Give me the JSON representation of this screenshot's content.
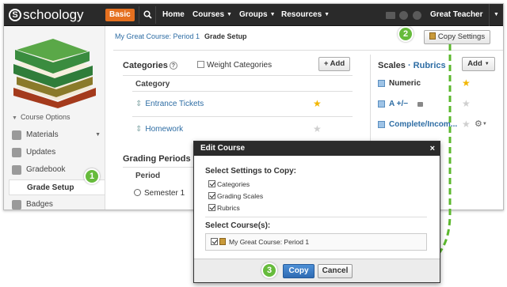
{
  "topbar": {
    "logo_text": "schoology",
    "plan_badge": "Basic",
    "nav": [
      {
        "label": "Home",
        "caret": ""
      },
      {
        "label": "Courses",
        "caret": "▼"
      },
      {
        "label": "Groups",
        "caret": "▼"
      },
      {
        "label": "Resources",
        "caret": "▼"
      }
    ],
    "user_name": "Great Teacher",
    "user_caret": "▼"
  },
  "sidebar": {
    "course_options": "Course Options",
    "items": [
      {
        "label": "Materials",
        "arrow": "▼"
      },
      {
        "label": "Updates",
        "arrow": ""
      },
      {
        "label": "Gradebook",
        "arrow": ""
      },
      {
        "label": "Grade Setup",
        "arrow": ""
      },
      {
        "label": "Badges",
        "arrow": ""
      }
    ]
  },
  "breadcrumb": {
    "course": "My Great Course: Period 1",
    "page": "Grade Setup"
  },
  "copy_settings_label": "Copy Settings",
  "categories": {
    "title": "Categories",
    "help": "?",
    "weight_label": "Weight Categories",
    "add_label": "+ Add",
    "column_header": "Category",
    "rows": [
      {
        "name": "Entrance Tickets",
        "default": true
      },
      {
        "name": "Homework",
        "default": false
      }
    ]
  },
  "grading_periods": {
    "title": "Grading Periods &",
    "column_header": "Period",
    "rows": [
      {
        "name": "Semester 1"
      }
    ]
  },
  "scales": {
    "title": "Scales",
    "separator": "·",
    "rubrics_label": "Rubrics",
    "add_label": "Add",
    "add_caret": "▼",
    "rows": [
      {
        "name": "Numeric",
        "default": true,
        "locked": false
      },
      {
        "name": "A +/−",
        "default": false,
        "locked": true
      },
      {
        "name": "Complete/Incom...",
        "default": false,
        "locked": false
      }
    ]
  },
  "dialog": {
    "title": "Edit Course",
    "close": "×",
    "settings_label": "Select Settings to Copy:",
    "settings": [
      "Categories",
      "Grading Scales",
      "Rubrics"
    ],
    "courses_label": "Select Course(s):",
    "courses": [
      "My Great Course: Period 1"
    ],
    "copy_label": "Copy",
    "cancel_label": "Cancel"
  },
  "steps": [
    "1",
    "2",
    "3"
  ],
  "colors": {
    "accent_orange": "#e5701f",
    "link_blue": "#2e6da4",
    "step_green": "#66bb3c",
    "arrow_green": "#5cb82e",
    "star_gold": "#f2b600"
  }
}
